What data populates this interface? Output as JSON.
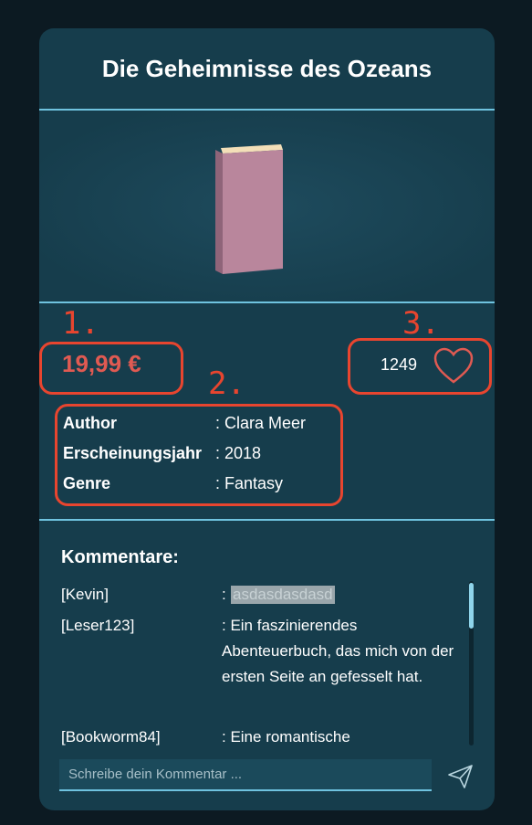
{
  "book": {
    "title": "Die Geheimnisse des Ozeans",
    "price": "19,99 €",
    "likes": "1249",
    "details": [
      {
        "key": "Author",
        "value": ": Clara Meer"
      },
      {
        "key": "Erscheinungsjahr",
        "value": ": 2018"
      },
      {
        "key": "Genre",
        "value": ": Fantasy"
      }
    ]
  },
  "comments": {
    "heading": "Kommentare:",
    "items": [
      {
        "user": "[Kevin]",
        "sep": ":",
        "text": "asdasdasdasd"
      },
      {
        "user": "[Leser123]",
        "text": ": Ein faszinierendes Abenteuerbuch, das mich von der ersten Seite an gefesselt hat."
      },
      {
        "user": "[Bookworm84]",
        "text": ": Eine romantische"
      }
    ],
    "input_placeholder": "Schreibe dein Kommentar ..."
  },
  "annotations": [
    "1.",
    "2.",
    "3."
  ],
  "colors": {
    "card": "#163d4c",
    "price": "#e05a52",
    "accent": "#6fc3df",
    "annotation": "#e8452f"
  },
  "icons": {
    "like": "heart-icon",
    "send": "send-icon"
  }
}
